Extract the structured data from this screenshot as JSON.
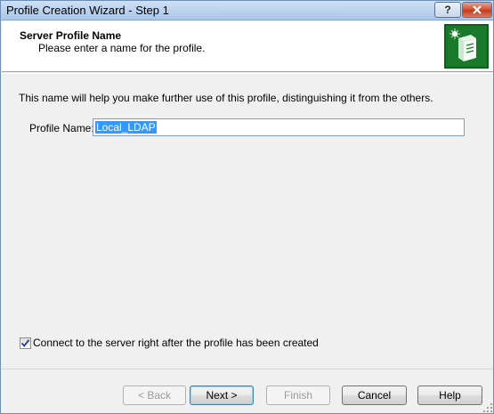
{
  "window": {
    "title": "Profile Creation Wizard - Step 1",
    "help_glyph": "?",
    "close_glyph": "X"
  },
  "header": {
    "title": "Server Profile Name",
    "subtitle": "Please enter a name for the profile.",
    "logo_icon": "server-tower-icon"
  },
  "body": {
    "description": "This name will help you make further use of this profile, distinguishing it from the others.",
    "profile_name_label": "Profile Name:",
    "profile_name_value": "Local_LDAP",
    "connect_checkbox": {
      "checked": true,
      "label": "Connect to the server right after the profile has been created"
    }
  },
  "buttons": {
    "back": "< Back",
    "next": "Next >",
    "finish": "Finish",
    "cancel": "Cancel",
    "help": "Help"
  },
  "colors": {
    "selection": "#3399ff",
    "logo_green": "#1a7a2c",
    "titlebar": "#bcd3ee"
  }
}
